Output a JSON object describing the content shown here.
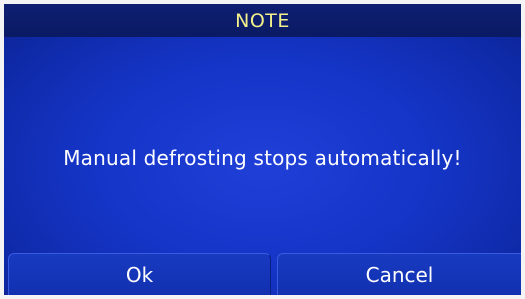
{
  "dialog": {
    "title": "NOTE",
    "message": "Manual defrosting stops automatically!",
    "buttons": {
      "ok_label": "Ok",
      "cancel_label": "Cancel"
    }
  },
  "colors": {
    "title_text": "#f2f08a",
    "title_bar": "#0e1f73",
    "screen_blue": "#1535c8",
    "text": "#ffffff"
  }
}
